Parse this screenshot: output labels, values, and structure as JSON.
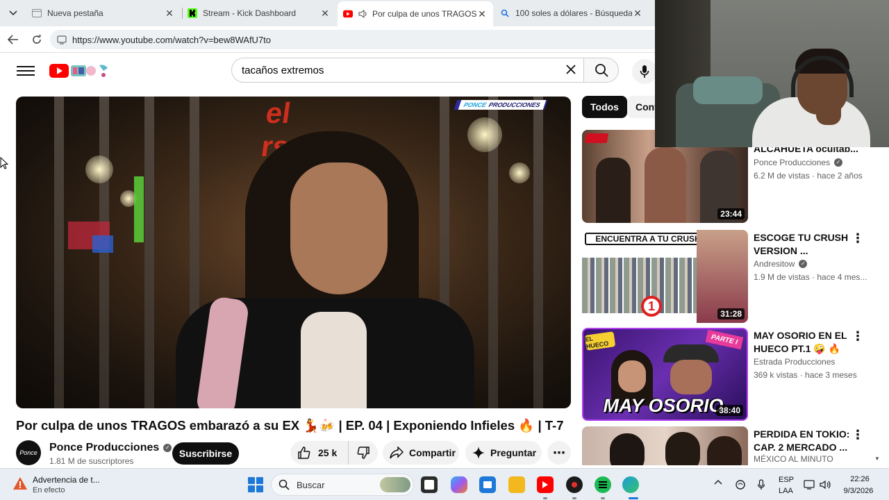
{
  "browser": {
    "tabs": [
      {
        "title": "Nueva pestaña",
        "favicon": "blank-page-icon"
      },
      {
        "title": "Stream - Kick Dashboard",
        "favicon": "kick-icon"
      },
      {
        "title": "Por culpa de unos TRAGOS em",
        "favicon": "youtube-icon",
        "audio": true
      },
      {
        "title": "100 soles a dólares - Búsqueda",
        "favicon": "search-icon"
      }
    ],
    "close_glyph": "✕",
    "url": "https://www.youtube.com/watch?v=bew8WAfU7to"
  },
  "youtube": {
    "search_value": "tacaños extremos",
    "video": {
      "watermark_brand": "PONCE",
      "watermark_sub": "PRODUCCIONES",
      "sign_text": "el rsu",
      "title": "Por culpa de unos TRAGOS embarazó a su EX 💃🍻 | EP. 04 | Exponiendo Infieles 🔥 | T-7",
      "channel": "Ponce Producciones",
      "channel_avatar_text": "Ponce",
      "subscribers": "1.81 M de suscriptores",
      "subscribe_label": "Suscribirse",
      "likes": "25 k",
      "share_label": "Compartir",
      "ask_label": "Preguntar",
      "more_glyph": "⋯"
    },
    "chips": [
      "Todos",
      "Cont"
    ],
    "recommendations": [
      {
        "title": "ALCAHUETA ocultab...",
        "channel": "Ponce Producciones",
        "verified": true,
        "meta": "6.2 M de vistas · hace 2 años",
        "duration": "23:44",
        "thumb_text": ""
      },
      {
        "title": "ESCOGE TU CRUSH VERSION ...",
        "channel": "Andresitow",
        "verified": true,
        "meta": "1.9 M de vistas · hace 4 mes...",
        "duration": "31:28",
        "thumb_text": "ENCUENTRA A TU CRUSH",
        "thumb_number": "1"
      },
      {
        "title": "MAY OSORIO EN EL HUECO PT.1 🤪 🔥",
        "channel": "Estrada Producciones",
        "verified": false,
        "meta": "369 k vistas · hace 3 meses",
        "duration": "38:40",
        "thumb_text": "MAY OSORIO",
        "thumb_corner": "PARTE I",
        "thumb_tag": "EL HUECO"
      },
      {
        "title": "PERDIDA EN TOKIO: CAP. 2 MERCADO ...",
        "channel": "MÉXICO AL MINUTO",
        "verified": false,
        "meta": "",
        "duration": "",
        "thumb_text": ""
      }
    ],
    "rec_more_glyph": "⋮"
  },
  "taskbar": {
    "notification_title": "Advertencia de t...",
    "notification_status": "En efecto",
    "search_label": "Buscar",
    "lang_top": "ESP",
    "lang_bottom": "LAA",
    "time": "22:26",
    "date": "9/3/2026"
  },
  "colors": {
    "youtube_red": "#ff0000",
    "subscribe_bg": "#0f0f0f",
    "chip_active_bg": "#0f0f0f",
    "windows_blue": "#1e78d7"
  }
}
